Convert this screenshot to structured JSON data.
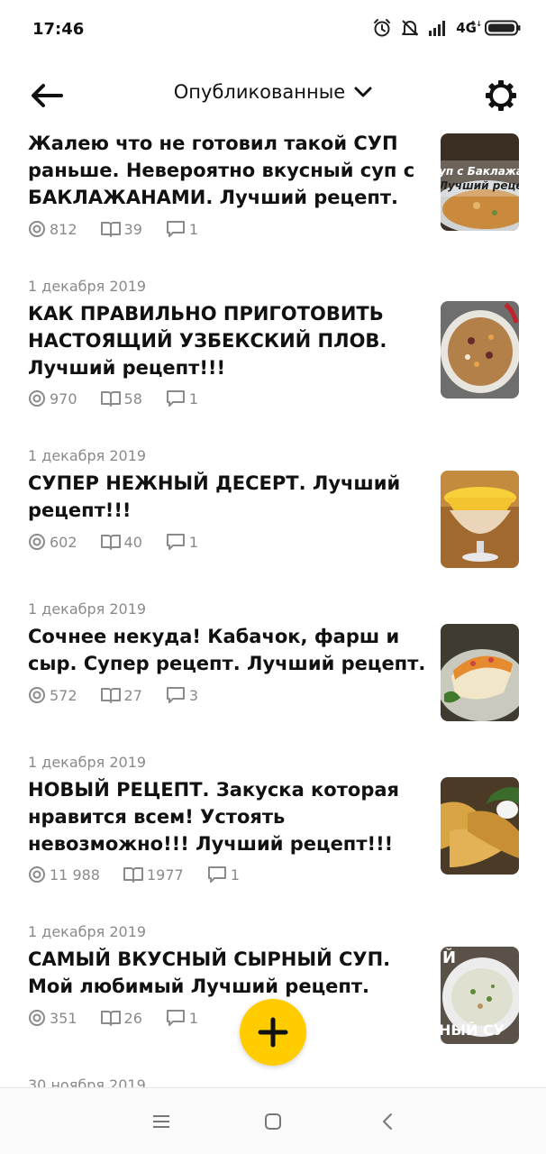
{
  "status_bar": {
    "time": "17:46",
    "network": "4G",
    "icons": [
      "alarm-icon",
      "do-not-disturb-icon",
      "signal-icon",
      "battery-icon"
    ]
  },
  "header": {
    "title": "Опубликованные",
    "icons": {
      "back": "arrow-left-icon",
      "dropdown": "chevron-down-icon",
      "settings": "gear-icon"
    }
  },
  "posts": [
    {
      "date": "",
      "title": "Жалею что не готовил такой СУП раньше. Невероятно вкусный суп с БАКЛАЖАНАМИ. Лучший рецепт.",
      "views": "812",
      "reads": "39",
      "comments": "1",
      "thumb_text": [
        "уп с Баклажа",
        "Лучший рецеп"
      ]
    },
    {
      "date": "1 декабря 2019",
      "title": "КАК ПРАВИЛЬНО ПРИГОТОВИТЬ НАСТОЯЩИЙ УЗБЕКСКИЙ ПЛОВ. Лучший рецепт!!!",
      "views": "970",
      "reads": "58",
      "comments": "1",
      "thumb_text": []
    },
    {
      "date": "1 декабря 2019",
      "title": "СУПЕР НЕЖНЫЙ ДЕСЕРТ. Лучший рецепт!!!",
      "views": "602",
      "reads": "40",
      "comments": "1",
      "thumb_text": []
    },
    {
      "date": "1 декабря 2019",
      "title": "Сочнее некуда! Кабачок, фарш и сыр. Супер рецепт. Лучший рецепт.",
      "views": "572",
      "reads": "27",
      "comments": "3",
      "thumb_text": []
    },
    {
      "date": "1 декабря 2019",
      "title": "НОВЫЙ РЕЦЕПТ. Закуска которая нравится всем! Устоять невозможно!!! Лучший рецепт!!!",
      "views": "11 988",
      "reads": "1977",
      "comments": "1",
      "thumb_text": []
    },
    {
      "date": "1 декабря 2019",
      "title": "САМЫЙ ВКУСНЫЙ СЫРНЫЙ СУП. Мой любимый Лучший рецепт.",
      "views": "351",
      "reads": "26",
      "comments": "1",
      "thumb_text": [
        "Й",
        "НЫЙ СУ"
      ]
    },
    {
      "date": "30 ноября 2019",
      "title": "",
      "views": "",
      "reads": "",
      "comments": "",
      "thumb_text": []
    }
  ],
  "fab": {
    "icon": "plus-icon"
  },
  "nav": {
    "icons": [
      "menu-icon",
      "home-square-icon",
      "back-triangle-icon"
    ]
  },
  "colors": {
    "accent": "#ffcc00",
    "meta_text": "#8a8a8a",
    "title_text": "#111111"
  }
}
